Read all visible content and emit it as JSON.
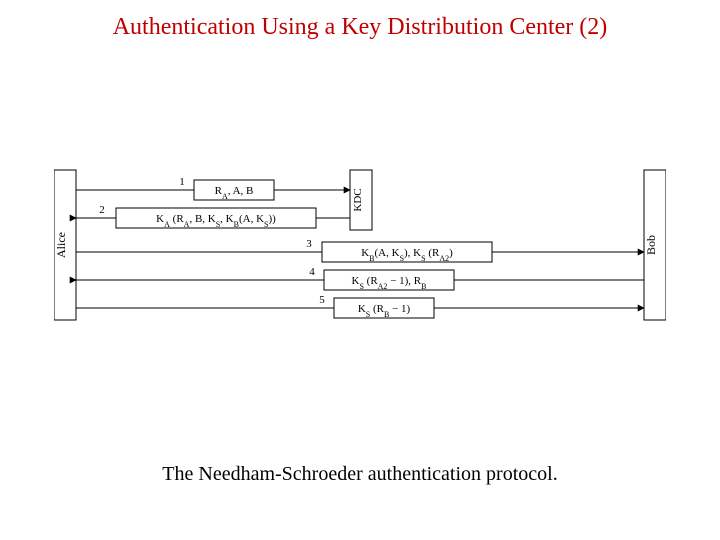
{
  "title": "Authentication Using a Key Distribution Center (2)",
  "caption": "The Needham-Schroeder authentication protocol.",
  "parties": {
    "alice": "Alice",
    "kdc": "KDC",
    "bob": "Bob"
  },
  "messages": {
    "m1": {
      "num": "1",
      "text_plain": "R",
      "sub1": "A",
      "tail1": ", A, B"
    },
    "m2": {
      "num": "2",
      "pre": "K",
      "sA": "A",
      "mid1": " (R",
      "sA2": "A",
      "mid2": ", B, K",
      "sS": "S",
      "mid3": ", K",
      "sB": "B",
      "tail": "(A, K",
      "sS2": "S",
      "end": "))"
    },
    "m3": {
      "num": "3",
      "pre": "K",
      "sB": "B",
      "mid1": "(A, K",
      "sS": "S",
      "mid2": "), K",
      "sS2": "S",
      "mid3": " (R",
      "sA2": "A2",
      "end": ")"
    },
    "m4": {
      "num": "4",
      "pre": "K",
      "sS": "S",
      "mid1": " (R",
      "sA2": "A2",
      "mid2": " − 1), R",
      "sB": "B"
    },
    "m5": {
      "num": "5",
      "pre": "K",
      "sS": "S",
      "mid1": " (R",
      "sB": "B",
      "end": " − 1)"
    }
  }
}
